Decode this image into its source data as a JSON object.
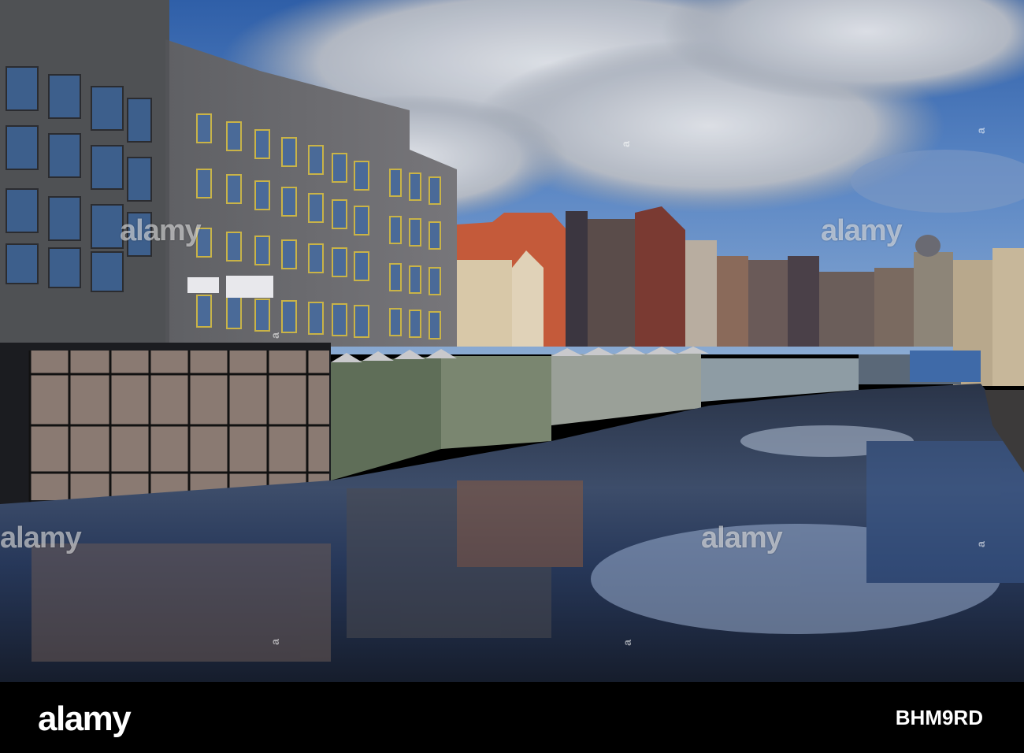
{
  "watermark": {
    "brand": "alamy",
    "edge_mark": "a"
  },
  "footer": {
    "logo": "alamy",
    "image_code": "BHM9RD"
  },
  "colors": {
    "sky": "#3f72b8",
    "cloud": "#c9ccd2",
    "water": "#1d2a40",
    "footer_bg": "#000000"
  }
}
